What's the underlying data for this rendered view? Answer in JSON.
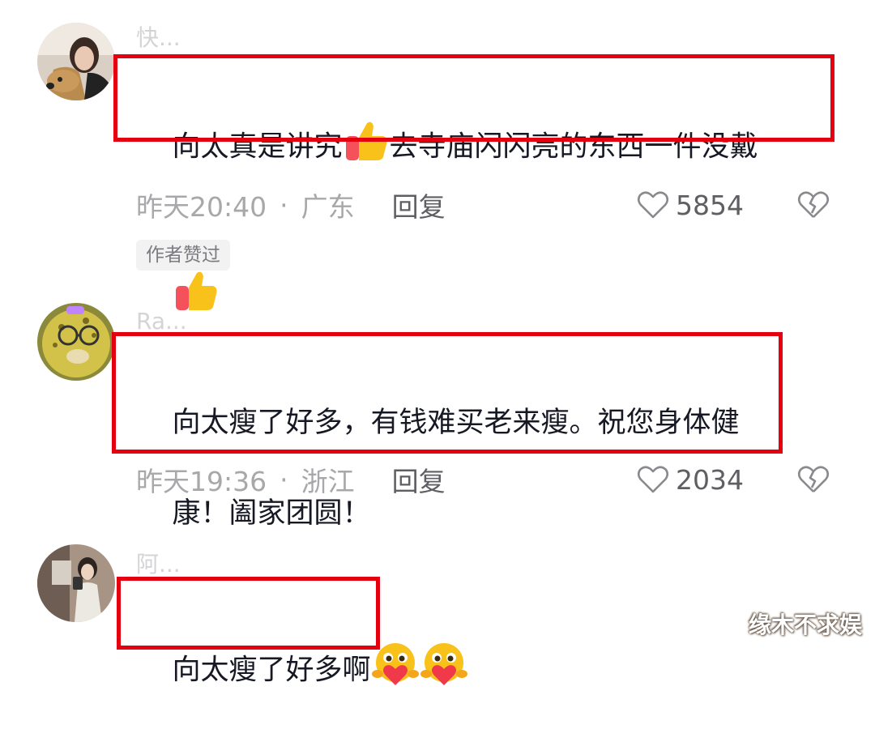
{
  "comments": [
    {
      "username": "快...",
      "text_before": "向太真是讲究",
      "text_after": "去寺庙闪闪亮的东西一件没戴",
      "emoji_1": "thumbs-up-emoji",
      "emoji_2": "thumbs-up-emoji",
      "time": "昨天20:40",
      "location": "广东",
      "reply_label": "回复",
      "likes": "5854",
      "badge": "作者赞过"
    },
    {
      "username": "Ra...",
      "text_line1": "向太瘦了好多，有钱难买老来瘦。祝您身体健",
      "text_line2": "康！阖家团圆！",
      "time": "昨天19:36",
      "location": "浙江",
      "reply_label": "回复",
      "likes": "2034"
    },
    {
      "username": "阿...",
      "text": "向太瘦了好多啊",
      "emoji_1": "heart-face-emoji",
      "emoji_2": "heart-face-emoji"
    }
  ],
  "separator": "·",
  "watermark": "缘木不求娱",
  "colors": {
    "highlight_box": "#e4000f",
    "meta_text": "#a8a8ab",
    "badge_bg": "#f2f2f3"
  }
}
